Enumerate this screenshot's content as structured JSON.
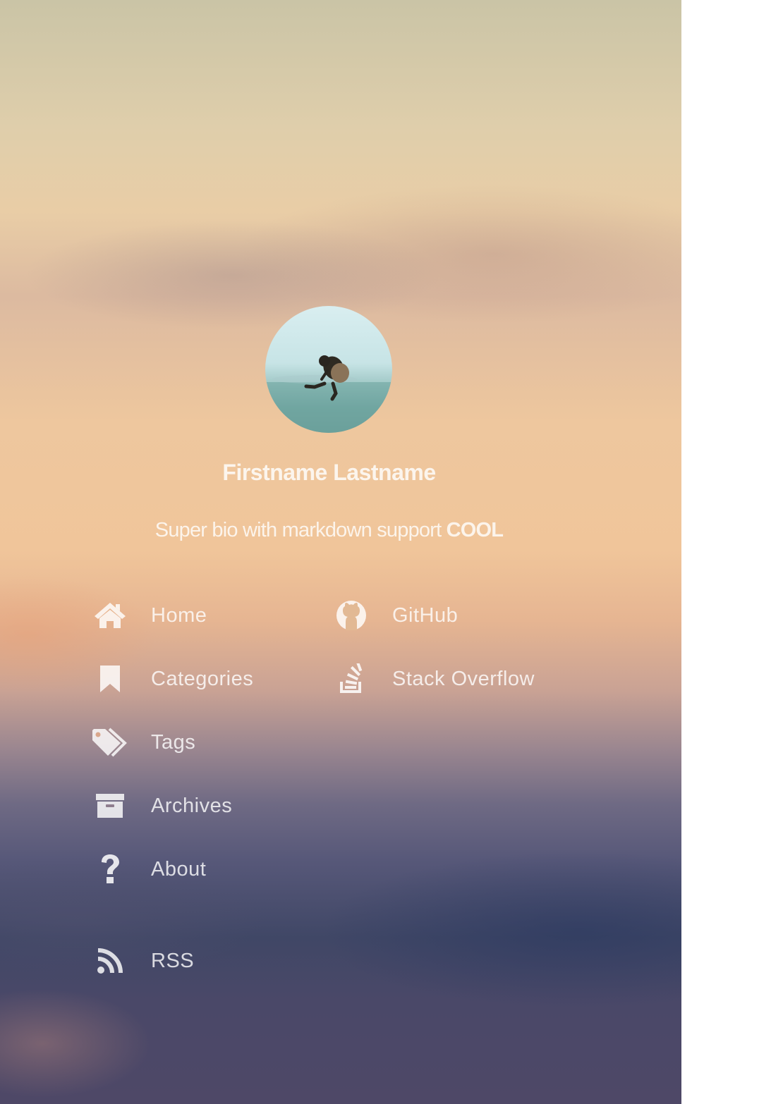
{
  "profile": {
    "name": "Firstname Lastname",
    "bio_text": "Super bio with markdown support ",
    "bio_bold": "COOL",
    "avatar_icon": "jumping-person-photo"
  },
  "nav_left": [
    {
      "label": "Home",
      "icon": "home-icon"
    },
    {
      "label": "Categories",
      "icon": "bookmark-icon"
    },
    {
      "label": "Tags",
      "icon": "tags-icon"
    },
    {
      "label": "Archives",
      "icon": "archive-icon"
    },
    {
      "label": "About",
      "icon": "question-icon"
    },
    {
      "label": "RSS",
      "icon": "rss-icon"
    }
  ],
  "nav_right": [
    {
      "label": "GitHub",
      "icon": "github-icon"
    },
    {
      "label": "Stack Overflow",
      "icon": "stackoverflow-icon"
    }
  ],
  "colors": {
    "text": "#ffffff",
    "page_background": "#ffffff"
  }
}
